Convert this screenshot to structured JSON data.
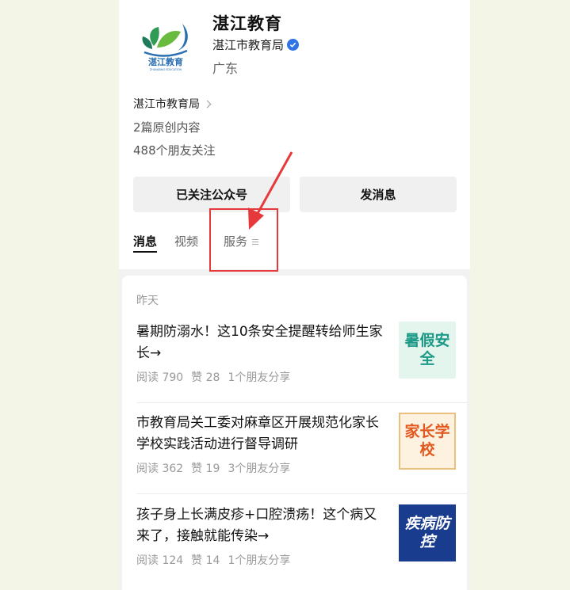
{
  "account": {
    "name": "湛江教育",
    "entity": "湛江市教育局",
    "region": "广东",
    "entity_link": "湛江市教育局",
    "original_count": "2篇原创内容",
    "friends_following": "488个朋友关注",
    "verified_color": "#2f73e6"
  },
  "logo": {
    "text": "湛江教育",
    "subtext": "ZHANJIANG EDUCATION"
  },
  "buttons": {
    "follow": "已关注公众号",
    "message": "发消息"
  },
  "tabs": [
    {
      "label": "消息",
      "active": true
    },
    {
      "label": "视频",
      "active": false
    },
    {
      "label": "服务",
      "active": false
    }
  ],
  "feed": {
    "date": "昨天",
    "articles": [
      {
        "title": "暑期防溺水！这10条安全提醒转给师生家长→",
        "reads": "阅读 790",
        "likes": "赞 28",
        "shares": "1个朋友分享",
        "thumb_text": "暑假安全"
      },
      {
        "title": "市教育局关工委对麻章区开展规范化家长学校实践活动进行督导调研",
        "reads": "阅读 362",
        "likes": "赞 19",
        "shares": "3个朋友分享",
        "thumb_text": "家长学校"
      },
      {
        "title": "孩子身上长满皮疹+口腔溃疡！这个病又来了，接触就能传染→",
        "reads": "阅读 124",
        "likes": "赞 14",
        "shares": "1个朋友分享",
        "thumb_text": "疾病防控"
      }
    ]
  },
  "annotation_color": "#e5393b"
}
